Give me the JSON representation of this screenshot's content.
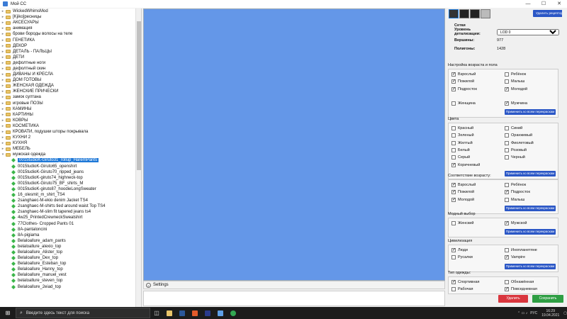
{
  "window": {
    "title": "Мой CC"
  },
  "tree": {
    "folders": [
      "WickedWhimsMod",
      "[Kjiko]ресницы",
      "АКСЕСУАРЫ",
      "анимация",
      "брови бороды волосы на теле",
      "ГЕНЕТИКА",
      "ДЕКОР",
      "ДЕТАЛЬ - ПАЛЬЦЫ",
      "ДЕТИ",
      "дефолтные ноги",
      "дефолтный скин",
      "ДИВАНЫ И КРЕСЛА",
      "ДОМ ГОТОВЫ",
      "ЖЕНСКАЯ ОДЕЖДА",
      "ЖЕНСКИЕ ПРИЧЕСКИ",
      "замок султана",
      "игровые ПОЗЫ",
      "КАМИНЫ",
      "КАРТИНЫ",
      "КОВРЫ",
      "КОСМЕТИКА",
      "КРОВАТИ, подушки шторы покрывала",
      "КУХНИ 2",
      "КУХНЯ",
      "МЕБЕЛЬ",
      "мужская одежда"
    ],
    "children": [
      "0015tudioK-Giruto31_rollup_HaremPants",
      "0015tudioK-Giruto65_openshirt",
      "0015tudioK-Giruto70_ripped_jeans",
      "0015tudioK-giruto74_highneck-top",
      "0015tudioK-Giruto75_BF_shirts_M",
      "0015tudioK-giruto87_hoodieLongSweater",
      "16_olesmit_m_shirt_TS4",
      "2sanghaec-M-ekio denim Jacket TS4",
      "2sanghaec-M-shirts tied around waist Top TS4",
      "2sanghaec-M-slim fit tapered jeans ts4",
      "4w25_PrintedCrewneckSweatshirt",
      "77Clothes- Cropped Pants 01",
      "8A-pantaloncini",
      "8A-pigiama",
      "Belaloallure_adam_pants",
      "belaloallure_alexio_top",
      "Belaloallure_Alister_top",
      "Belaloallure_Dex_top",
      "Belaloallure_Esteban_top",
      "Belaloallure_Hanny_top",
      "Belaloallure_manuel_vest",
      "belaloallure_steven_top",
      "Belaloallure_2eiad_top"
    ],
    "selected_index": 0
  },
  "settings": {
    "label": "Settings"
  },
  "right": {
    "delete_preset": "Удалить рецептор",
    "mesh": {
      "header": "Сетки",
      "lod_label": "Уровень детализации:",
      "lod_value": "LOD 0",
      "vertices_label": "Вершины:",
      "vertices_value": "977",
      "polygons_label": "Полигоны:",
      "polygons_value": "1428"
    },
    "apply_label": "Применить ко всем перекраскам",
    "sections": [
      {
        "title": "Настройка возраста и пола",
        "items": [
          {
            "label": "Взрослый",
            "on": true
          },
          {
            "label": "Ребёнок",
            "on": false
          },
          {
            "label": "Пожилой",
            "on": true
          },
          {
            "label": "Малыш",
            "on": false
          },
          {
            "label": "Подросток",
            "on": true
          },
          {
            "label": "Молодой",
            "on": true
          },
          {
            "label": "",
            "on": null
          },
          {
            "label": "",
            "on": null
          },
          {
            "label": "Женщина",
            "on": false
          },
          {
            "label": "Мужчина",
            "on": true
          }
        ]
      },
      {
        "title": "Цвета",
        "items": [
          {
            "label": "Красный",
            "on": false
          },
          {
            "label": "Синий",
            "on": false
          },
          {
            "label": "Зеленый",
            "on": false
          },
          {
            "label": "Оранжевый",
            "on": false
          },
          {
            "label": "Желтый",
            "on": false
          },
          {
            "label": "Фиолетовый",
            "on": false
          },
          {
            "label": "Белый",
            "on": false
          },
          {
            "label": "Розовый",
            "on": false
          },
          {
            "label": "Серый",
            "on": false
          },
          {
            "label": "Черный",
            "on": false
          },
          {
            "label": "Коричневый",
            "on": true
          }
        ]
      },
      {
        "title": "Соответствие возрасту:",
        "items": [
          {
            "label": "Взрослый",
            "on": true
          },
          {
            "label": "Ребёнок",
            "on": false
          },
          {
            "label": "Пожилой",
            "on": true
          },
          {
            "label": "Подросток",
            "on": true
          },
          {
            "label": "Молодой",
            "on": true
          },
          {
            "label": "Малыш",
            "on": false
          }
        ]
      },
      {
        "title": "Модный выбор",
        "items": [
          {
            "label": "Женский",
            "on": false
          },
          {
            "label": "Мужской",
            "on": true
          }
        ]
      },
      {
        "title": "Цивилизация",
        "items": [
          {
            "label": "Люди",
            "on": true
          },
          {
            "label": "Инопланетяне",
            "on": false
          },
          {
            "label": "Русалки",
            "on": false
          },
          {
            "label": "Vampire",
            "on": true
          }
        ]
      },
      {
        "title": "Тип одежды:",
        "items": [
          {
            "label": "Спортивная",
            "on": true
          },
          {
            "label": "Обнажённая",
            "on": false
          },
          {
            "label": "Рабочая",
            "on": false
          },
          {
            "label": "Повседневная",
            "on": true
          }
        ]
      }
    ],
    "delete_btn": "Удалить",
    "save_btn": "Сохранить"
  },
  "taskbar": {
    "search_placeholder": "Введите здесь текст для поиска",
    "time": "16:29",
    "date": "19.04.2021",
    "lang": "РУС"
  },
  "colors": {
    "preview_bg": "#6497e8",
    "accent": "#2b57c6",
    "delete": "#d9363e",
    "save": "#2e9e43"
  }
}
